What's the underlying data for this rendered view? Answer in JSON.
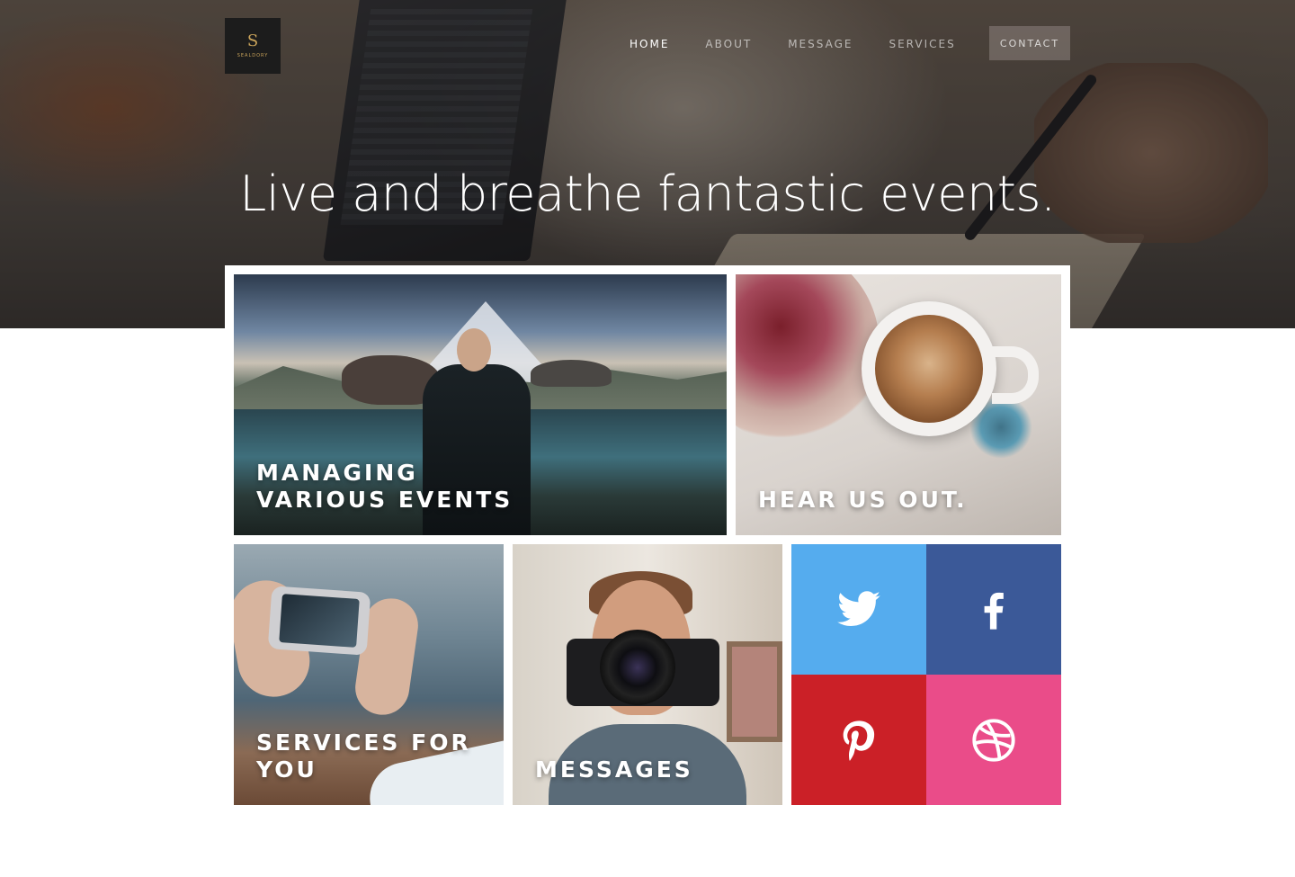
{
  "brand": {
    "logo_letter": "S",
    "logo_word": "SEALDORY"
  },
  "nav": {
    "items": [
      {
        "label": "HOME",
        "active": true
      },
      {
        "label": "ABOUT",
        "active": false
      },
      {
        "label": "MESSAGE",
        "active": false
      },
      {
        "label": "SERVICES",
        "active": false
      }
    ],
    "contact_label": "CONTACT"
  },
  "hero": {
    "headline": "Live and breathe fantastic events."
  },
  "tiles": {
    "events": {
      "line1": "MANAGING",
      "line2": "VARIOUS EVENTS"
    },
    "hear": {
      "line1": "HEAR US OUT."
    },
    "services": {
      "line1": "SERVICES FOR",
      "line2": "YOU"
    },
    "messages": {
      "line1": "MESSAGES"
    }
  },
  "social": [
    {
      "name": "twitter",
      "icon": "twitter-icon",
      "color": "#55acee"
    },
    {
      "name": "facebook",
      "icon": "facebook-icon",
      "color": "#3b5998"
    },
    {
      "name": "pinterest",
      "icon": "pinterest-icon",
      "color": "#cb2027"
    },
    {
      "name": "dribbble",
      "icon": "dribbble-icon",
      "color": "#ea4c89"
    }
  ]
}
